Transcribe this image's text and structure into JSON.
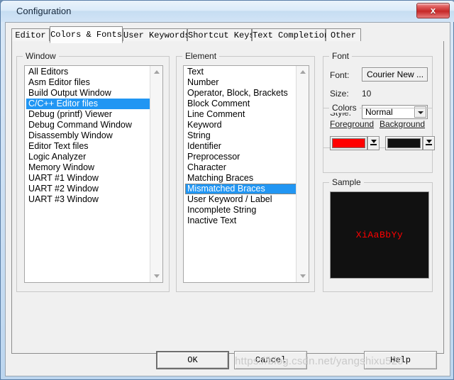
{
  "window": {
    "title": "Configuration",
    "close_label": "x"
  },
  "tabs": [
    {
      "label": "Editor",
      "active": false
    },
    {
      "label": "Colors & Fonts",
      "active": true
    },
    {
      "label": "User Keywords",
      "active": false
    },
    {
      "label": "Shortcut Keys",
      "active": false
    },
    {
      "label": "Text Completion",
      "active": false
    },
    {
      "label": "Other",
      "active": false
    }
  ],
  "window_group": {
    "legend": "Window",
    "items": [
      "All Editors",
      "Asm Editor files",
      "Build Output Window",
      "C/C++ Editor files",
      "Debug (printf) Viewer",
      "Debug Command Window",
      "Disassembly Window",
      "Editor Text files",
      "Logic Analyzer",
      "Memory Window",
      "UART #1 Window",
      "UART #2 Window",
      "UART #3 Window"
    ],
    "selected_index": 3
  },
  "element_group": {
    "legend": "Element",
    "items": [
      "Text",
      "Number",
      "Operator, Block, Brackets",
      "Block Comment",
      "Line Comment",
      "Keyword",
      "String",
      "Identifier",
      "Preprocessor",
      "Character",
      "Matching Braces",
      "Mismatched Braces",
      "User Keyword / Label",
      "Incomplete String",
      "Inactive Text"
    ],
    "selected_index": 11
  },
  "font_group": {
    "legend": "Font",
    "font_label": "Font:",
    "font_value": "Courier New ...",
    "size_label": "Size:",
    "size_value": "10",
    "style_label": "Style:",
    "style_value": "Normal"
  },
  "colors_group": {
    "legend": "Colors",
    "foreground_label": "Foreground",
    "background_label": "Background",
    "foreground_color": "#ff0000",
    "background_color": "#111111"
  },
  "sample_group": {
    "legend": "Sample",
    "text": "XiAaBbYy",
    "text_color": "#ff0000",
    "bg_color": "#111111"
  },
  "footer": {
    "ok": "OK",
    "cancel": "Cancel",
    "help": "Help",
    "watermark": "https://blog.csdn.net/yangshixu520"
  }
}
